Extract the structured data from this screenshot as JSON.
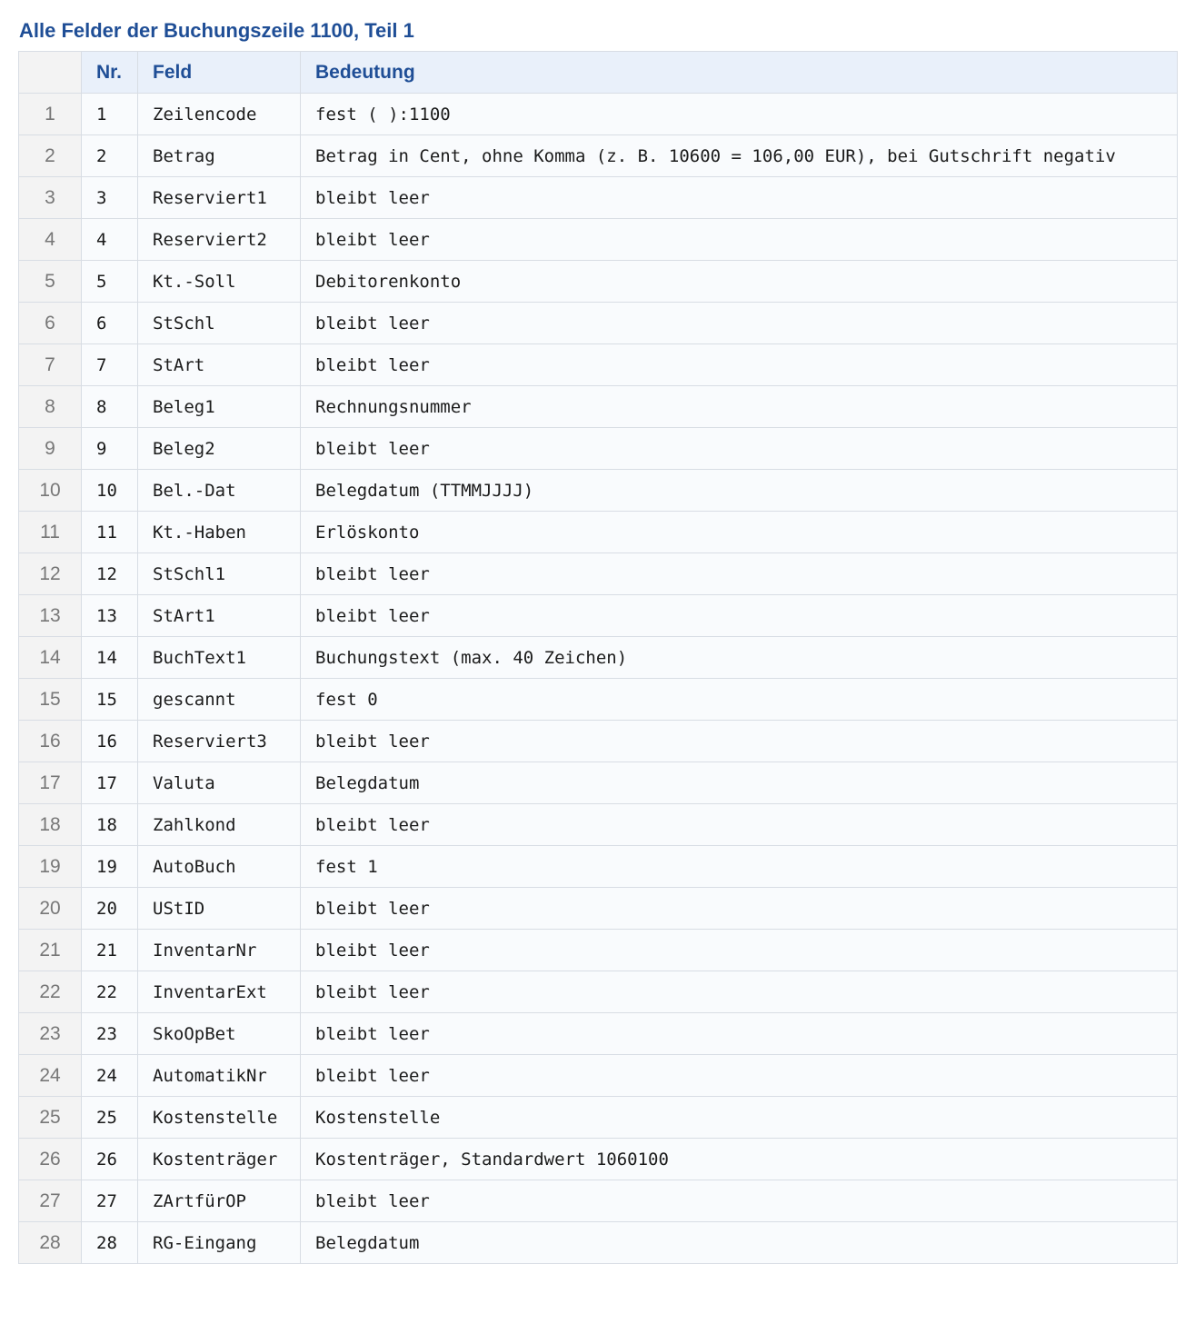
{
  "title": "Alle Felder der Buchungszeile 1100, Teil 1",
  "table": {
    "headers": [
      "",
      "Nr.",
      "Feld",
      "Bedeutung"
    ],
    "rows": [
      {
        "index": "1",
        "nr": "1",
        "feld": "Zeilencode",
        "bedeutung": "fest ( ):1100"
      },
      {
        "index": "2",
        "nr": "2",
        "feld": "Betrag",
        "bedeutung": "Betrag in Cent, ohne Komma (z. B. 10600 = 106,00 EUR), bei Gutschrift negativ"
      },
      {
        "index": "3",
        "nr": "3",
        "feld": "Reserviert1",
        "bedeutung": "bleibt leer"
      },
      {
        "index": "4",
        "nr": "4",
        "feld": "Reserviert2",
        "bedeutung": "bleibt leer"
      },
      {
        "index": "5",
        "nr": "5",
        "feld": "Kt.-Soll",
        "bedeutung": "Debitorenkonto"
      },
      {
        "index": "6",
        "nr": "6",
        "feld": "StSchl",
        "bedeutung": "bleibt leer"
      },
      {
        "index": "7",
        "nr": "7",
        "feld": "StArt",
        "bedeutung": "bleibt leer"
      },
      {
        "index": "8",
        "nr": "8",
        "feld": "Beleg1",
        "bedeutung": "Rechnungsnummer"
      },
      {
        "index": "9",
        "nr": "9",
        "feld": "Beleg2",
        "bedeutung": "bleibt leer"
      },
      {
        "index": "10",
        "nr": "10",
        "feld": "Bel.-Dat",
        "bedeutung": "Belegdatum (TTMMJJJJ)"
      },
      {
        "index": "11",
        "nr": "11",
        "feld": "Kt.-Haben",
        "bedeutung": "Erlöskonto"
      },
      {
        "index": "12",
        "nr": "12",
        "feld": "StSchl1",
        "bedeutung": "bleibt leer"
      },
      {
        "index": "13",
        "nr": "13",
        "feld": "StArt1",
        "bedeutung": "bleibt leer"
      },
      {
        "index": "14",
        "nr": "14",
        "feld": "BuchText1",
        "bedeutung": "Buchungstext (max. 40 Zeichen)"
      },
      {
        "index": "15",
        "nr": "15",
        "feld": "gescannt",
        "bedeutung": "fest 0"
      },
      {
        "index": "16",
        "nr": "16",
        "feld": "Reserviert3",
        "bedeutung": "bleibt leer"
      },
      {
        "index": "17",
        "nr": "17",
        "feld": "Valuta",
        "bedeutung": "Belegdatum"
      },
      {
        "index": "18",
        "nr": "18",
        "feld": "Zahlkond",
        "bedeutung": "bleibt leer"
      },
      {
        "index": "19",
        "nr": "19",
        "feld": "AutoBuch",
        "bedeutung": "fest 1"
      },
      {
        "index": "20",
        "nr": "20",
        "feld": "UStID",
        "bedeutung": "bleibt leer"
      },
      {
        "index": "21",
        "nr": "21",
        "feld": "InventarNr",
        "bedeutung": "bleibt leer"
      },
      {
        "index": "22",
        "nr": "22",
        "feld": "InventarExt",
        "bedeutung": "bleibt leer"
      },
      {
        "index": "23",
        "nr": "23",
        "feld": "SkoOpBet",
        "bedeutung": "bleibt leer"
      },
      {
        "index": "24",
        "nr": "24",
        "feld": "AutomatikNr",
        "bedeutung": "bleibt leer"
      },
      {
        "index": "25",
        "nr": "25",
        "feld": "Kostenstelle",
        "bedeutung": "Kostenstelle"
      },
      {
        "index": "26",
        "nr": "26",
        "feld": "Kostenträger",
        "bedeutung": "Kostenträger, Standardwert 1060100"
      },
      {
        "index": "27",
        "nr": "27",
        "feld": "ZArtfürOP",
        "bedeutung": "bleibt leer"
      },
      {
        "index": "28",
        "nr": "28",
        "feld": "RG-Eingang",
        "bedeutung": "Belegdatum"
      }
    ]
  },
  "colors": {
    "title": "#1f4e96",
    "header_text": "#1f4e96",
    "header_background": "#e9f0fa",
    "index_background": "#f3f3f3",
    "index_text": "#777777",
    "cell_background": "#f9fbfd",
    "border": "#d8dde4",
    "cell_text": "#1b1b1b"
  }
}
